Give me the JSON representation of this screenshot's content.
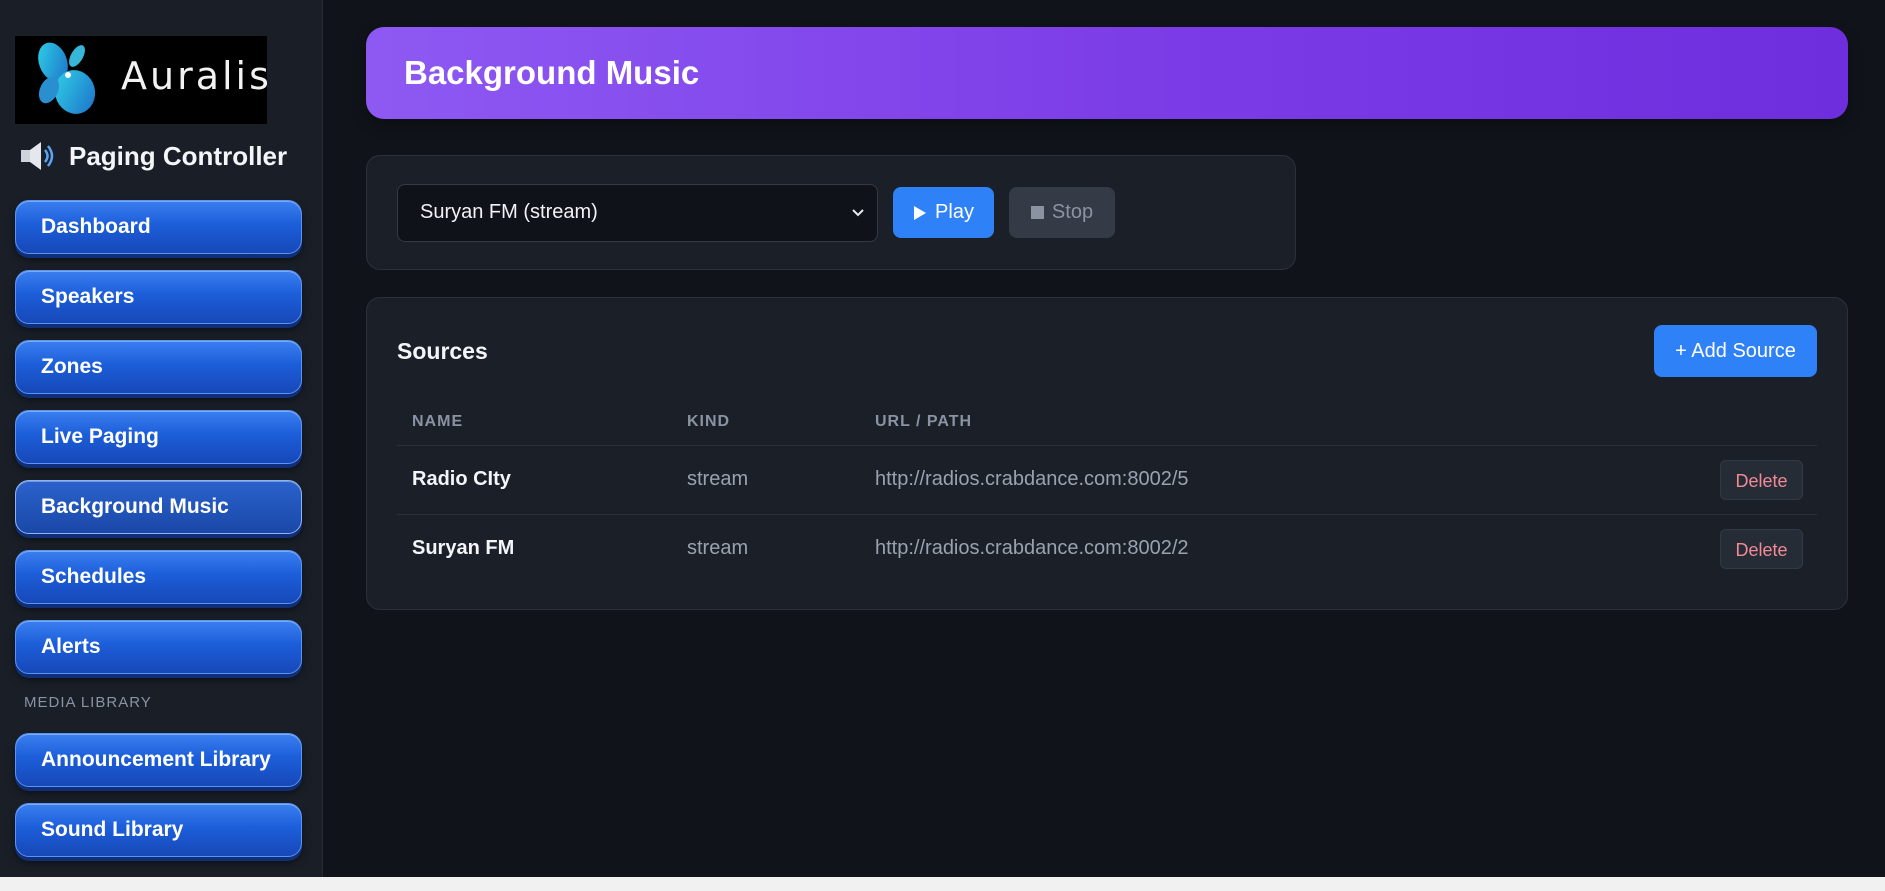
{
  "sidebar": {
    "logo_text": "Auralis",
    "brand_title": "Paging Controller",
    "nav_items": [
      {
        "label": "Dashboard"
      },
      {
        "label": "Speakers"
      },
      {
        "label": "Zones"
      },
      {
        "label": "Live Paging"
      },
      {
        "label": "Background Music",
        "active": true
      },
      {
        "label": "Schedules"
      },
      {
        "label": "Alerts"
      }
    ],
    "section_label": "MEDIA LIBRARY",
    "media_items": [
      {
        "label": "Announcement Library"
      },
      {
        "label": "Sound Library"
      }
    ]
  },
  "header": {
    "title": "Background Music"
  },
  "player": {
    "selected_source": "Suryan FM (stream)",
    "play_label": "Play",
    "stop_label": "Stop"
  },
  "sources": {
    "title": "Sources",
    "add_label": "+ Add Source",
    "columns": [
      "NAME",
      "KIND",
      "URL / PATH"
    ],
    "rows": [
      {
        "name": "Radio CIty",
        "kind": "stream",
        "url": "http://radios.crabdance.com:8002/5",
        "action": "Delete"
      },
      {
        "name": "Suryan FM",
        "kind": "stream",
        "url": "http://radios.crabdance.com:8002/2",
        "action": "Delete"
      }
    ]
  },
  "colors": {
    "accent": "#2f81f7",
    "header_gradient_start": "#8e59f3",
    "header_gradient_end": "#6e2ede",
    "nav_button": "#1c5ed9",
    "delete_text": "#f08a96"
  }
}
